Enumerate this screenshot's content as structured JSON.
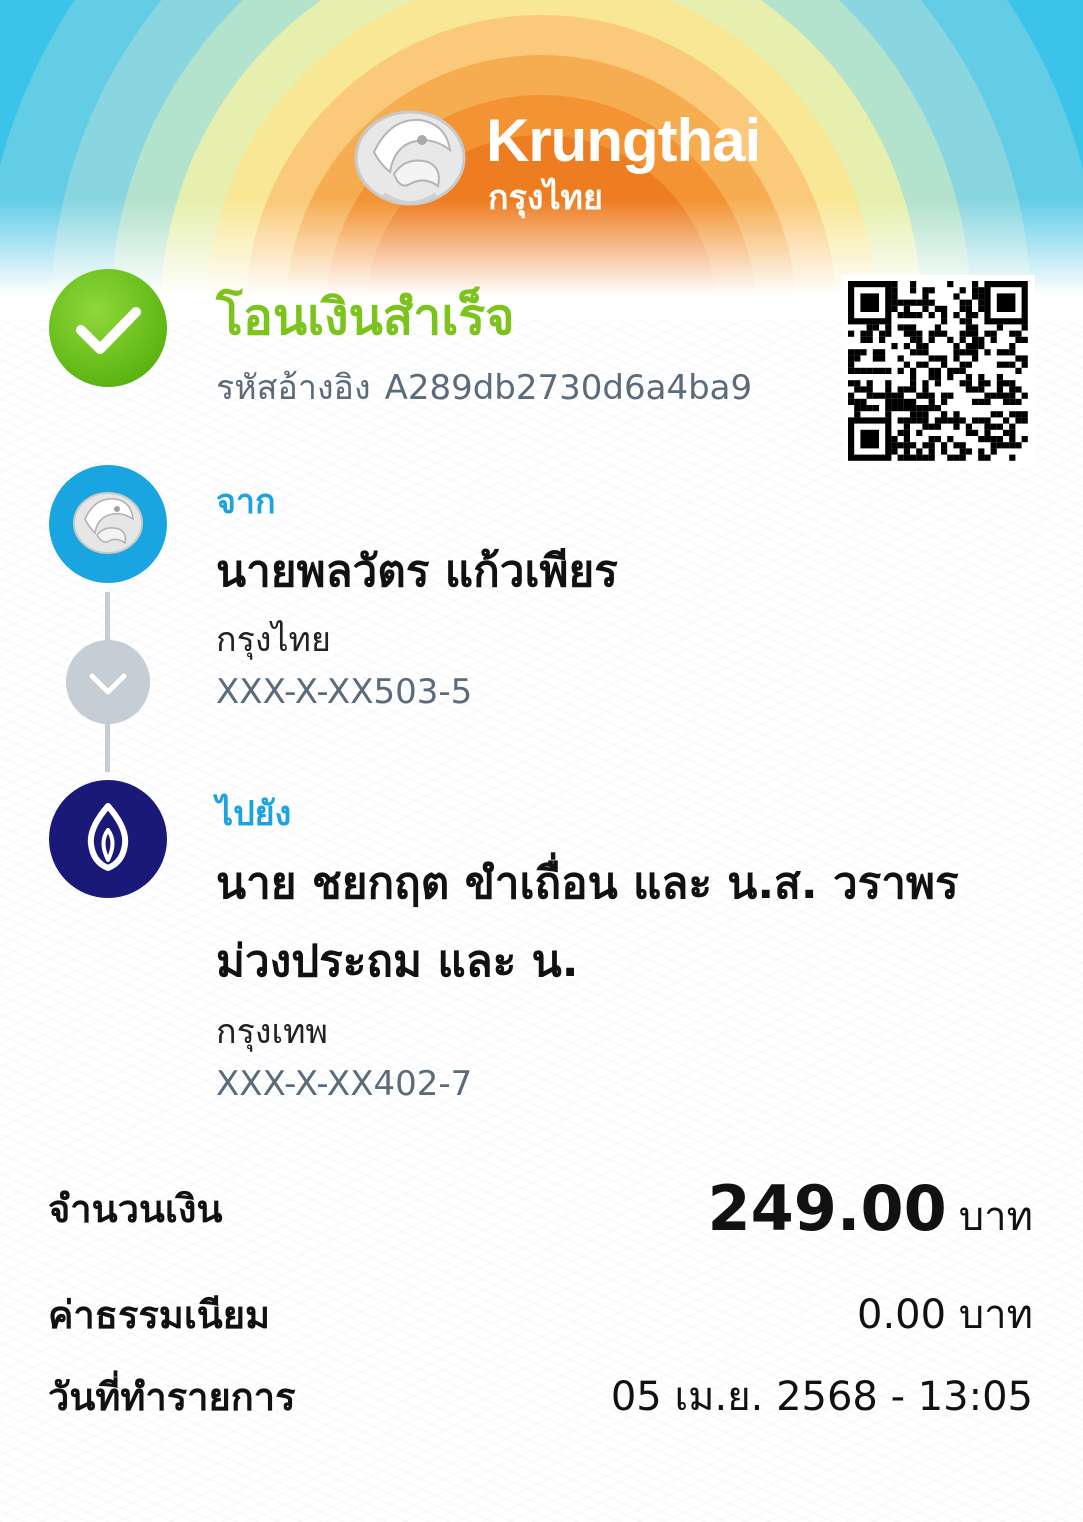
{
  "header": {
    "brand_name": "Krungthai",
    "brand_name_th": "กรุงไทย",
    "logo_icon": "krungthai-phoenix-icon",
    "rainbow_colors": [
      "#3cc3ea",
      "#8ad6e0",
      "#cde9b8",
      "#f6ef9c",
      "#f9cf78",
      "#f5a13a",
      "#ed7a1f"
    ]
  },
  "status": {
    "icon": "check-icon",
    "color": "#7cc41b",
    "title": "โอนเงินสำเร็จ",
    "ref_label": "รหัสอ้างอิง",
    "ref_code": "A289db2730d6a4ba9"
  },
  "qr": {
    "icon": "qr-code-icon"
  },
  "from": {
    "label": "จาก",
    "name": "นายพลวัตร แก้วเพียร",
    "bank": "กรุงไทย",
    "account": "XXX-X-XX503-5",
    "logo_icon": "krungthai-bank-icon",
    "logo_color": "#18a5e0"
  },
  "connector": {
    "icon": "chevron-down-icon"
  },
  "to": {
    "label": "ไปยัง",
    "name": "นาย ชยกฤต ขำเถื่อน และ น.ส. วราพร ม่วงประถม และ น.",
    "bank": "กรุงเทพ",
    "account": "XXX-X-XX402-7",
    "logo_icon": "bangkok-bank-lotus-icon",
    "logo_color": "#1b1978"
  },
  "details": {
    "amount_label": "จำนวนเงิน",
    "amount_value": "249.00",
    "amount_unit": "บาท",
    "fee_label": "ค่าธรรมเนียม",
    "fee_value": "0.00 บาท",
    "date_label": "วันที่ทำรายการ",
    "date_value": "05 เม.ย. 2568 - 13:05"
  }
}
